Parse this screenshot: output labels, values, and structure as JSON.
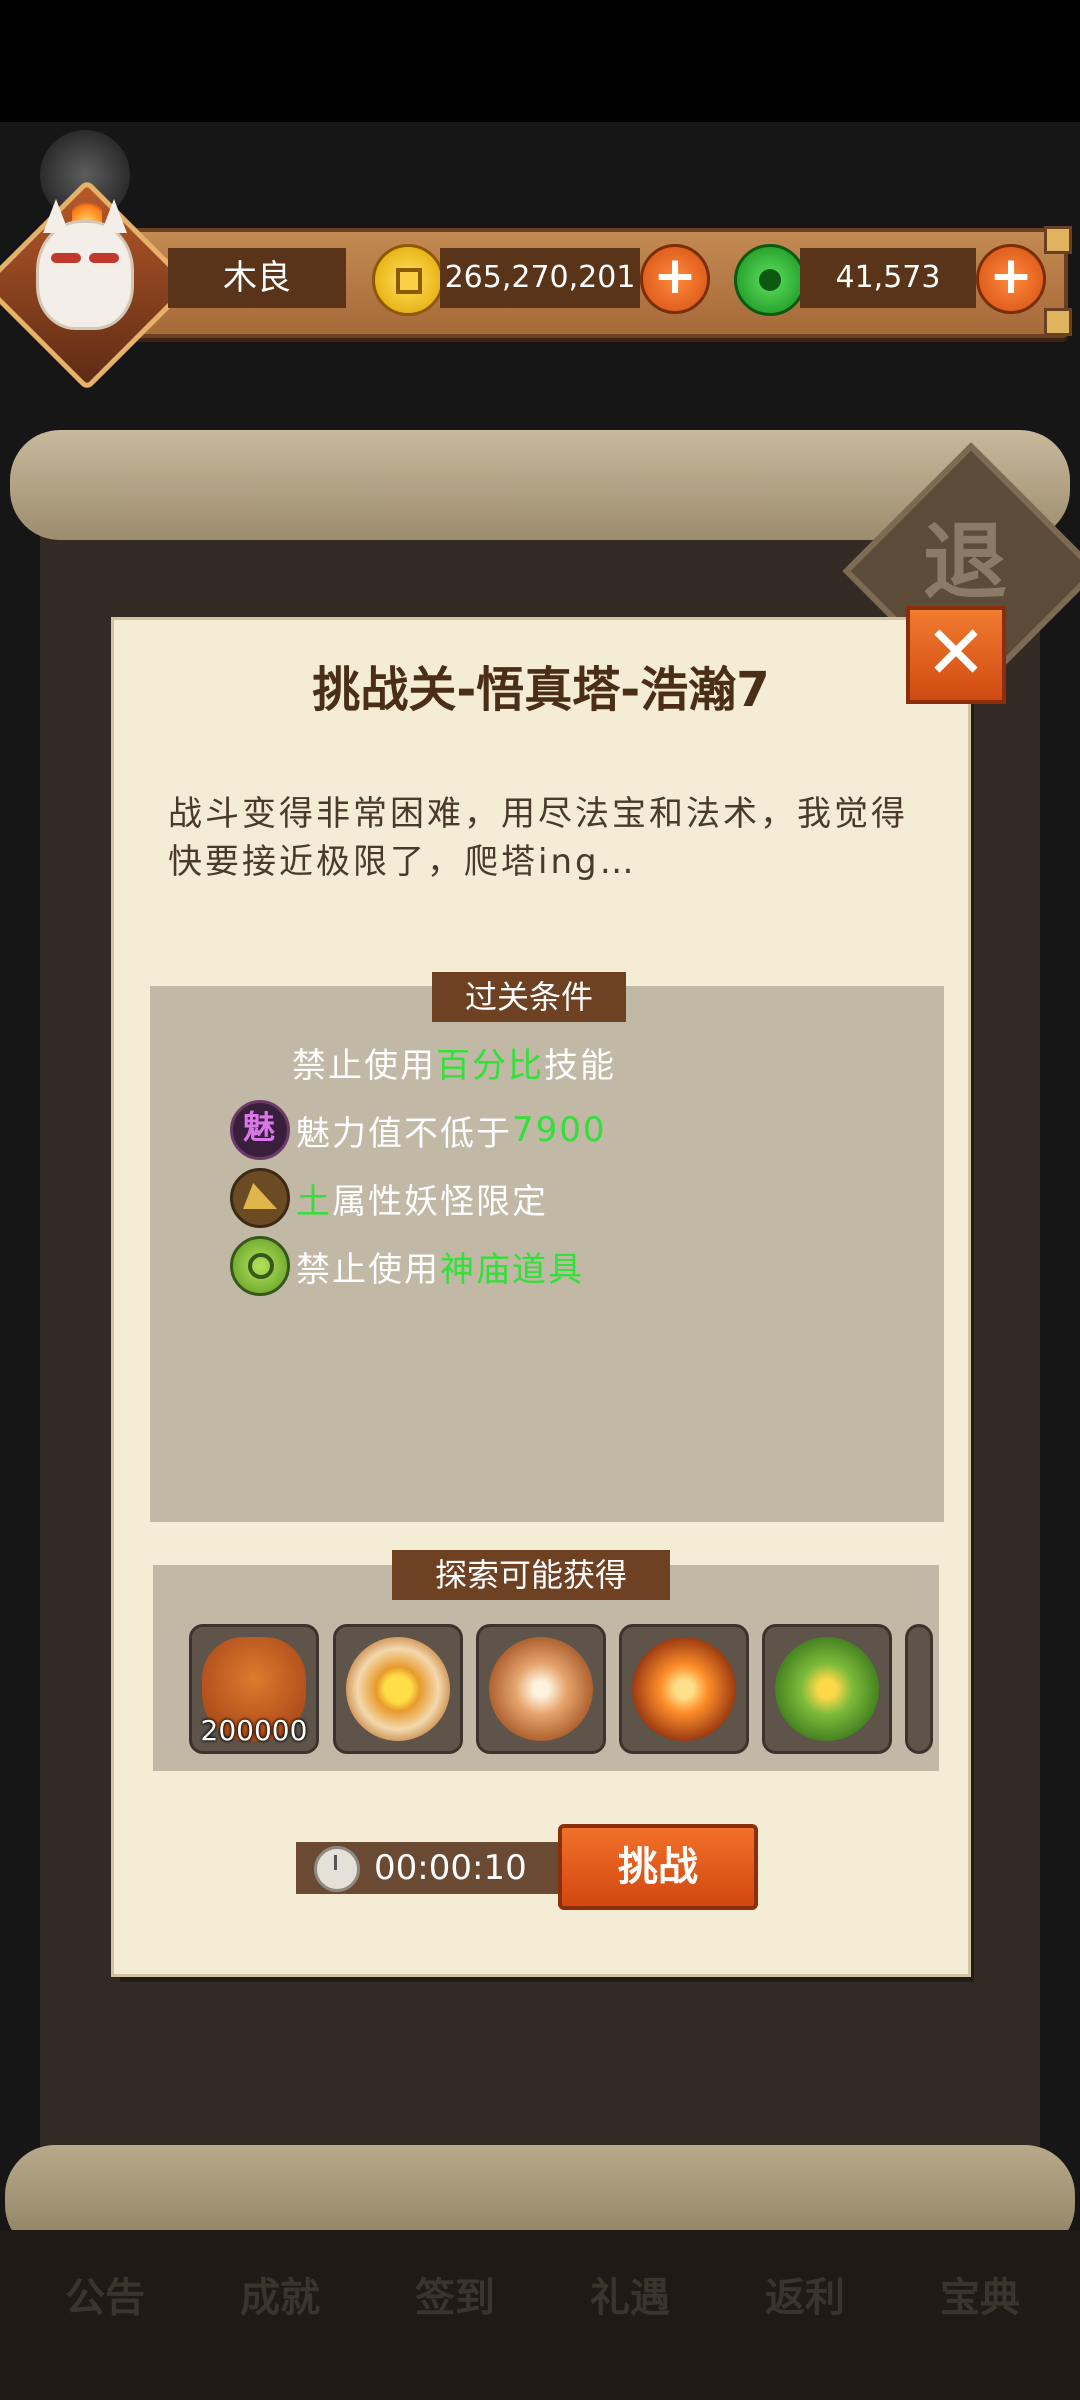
{
  "header": {
    "player_name": "木良",
    "coins": "265,270,201",
    "jade": "41,573",
    "add_coins_label": "+",
    "add_jade_label": "+"
  },
  "background": {
    "retreat_label": "退",
    "bottom_tabs": [
      "公告",
      "成就",
      "签到",
      "礼遇",
      "返利",
      "宝典"
    ]
  },
  "dialog": {
    "close_label": "✕",
    "title": "挑战关-悟真塔-浩瀚7",
    "description": "战斗变得非常困难，用尽法宝和法术，我觉得快要接近极限了，爬塔ing…",
    "conditions_title": "过关条件",
    "conditions": [
      {
        "prefix": "禁止使用",
        "highlight": "百分比",
        "suffix": "技能",
        "icon": "none"
      },
      {
        "prefix": "魅力值不低于",
        "highlight": "7900",
        "suffix": "",
        "icon": "charm-icon",
        "icon_text": "魅"
      },
      {
        "prefix": "",
        "highlight": "土",
        "suffix": "属性妖怪限定",
        "icon": "earth-attribute-icon"
      },
      {
        "prefix": "禁止使用",
        "highlight": "神庙道具",
        "suffix": "",
        "icon": "temple-item-icon"
      }
    ],
    "rewards_title": "探索可能获得",
    "rewards": [
      {
        "icon": "coin-bag-icon",
        "count": "200000"
      },
      {
        "icon": "compass-star-icon",
        "count": ""
      },
      {
        "icon": "swirl-orb-icon",
        "count": ""
      },
      {
        "icon": "fire-orb-icon",
        "count": ""
      },
      {
        "icon": "green-orb-icon",
        "count": ""
      }
    ],
    "timer": "00:00:10",
    "challenge_label": "挑战"
  },
  "colors": {
    "highlight_green": "#32e03a",
    "button_orange": "#e35a1b",
    "dialog_bg": "#f5ecd6",
    "panel_bg": "#c1b8a5"
  }
}
